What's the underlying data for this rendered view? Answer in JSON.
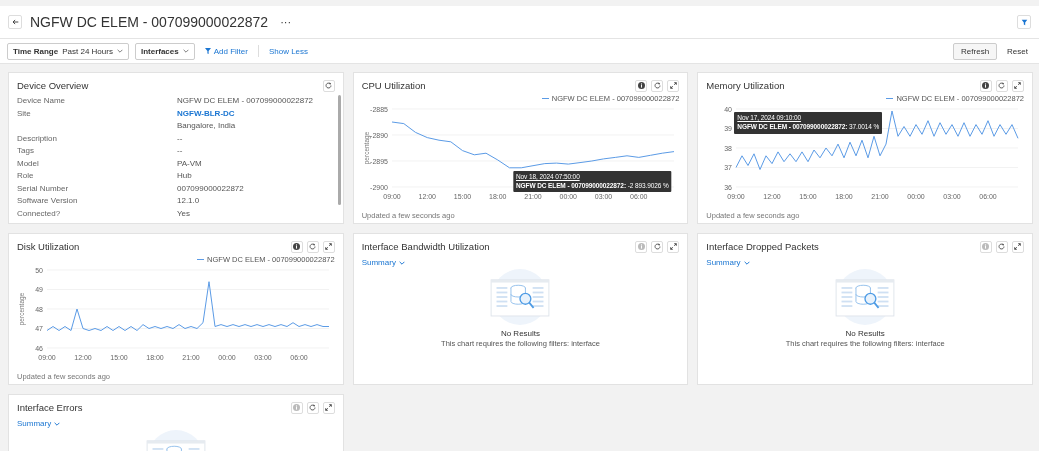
{
  "header": {
    "title": "NGFW DC ELEM - 007099000022872",
    "more": "···"
  },
  "filter_bar": {
    "time_range": {
      "label": "Time Range",
      "value": "Past 24 Hours"
    },
    "interfaces": {
      "label": "Interfaces"
    },
    "add_filter": "Add Filter",
    "show_less": "Show Less",
    "refresh": "Refresh",
    "reset": "Reset"
  },
  "panels": [
    {
      "kind": "details",
      "title": "Device Overview",
      "tools": [
        {
          "kind": "refresh",
          "disabled": false
        }
      ],
      "fields": [
        {
          "label": "Device Name",
          "value": "NGFW DC ELEM - 007099000022872"
        },
        {
          "label": "Site",
          "value": "NGFW-BLR-DC",
          "link": true,
          "note": "Bangalore, India"
        },
        {
          "label": "Description",
          "value": "--"
        },
        {
          "label": "Tags",
          "value": "--"
        },
        {
          "label": "Model",
          "value": "PA-VM"
        },
        {
          "label": "Role",
          "value": "Hub"
        },
        {
          "label": "Serial Number",
          "value": "007099000022872"
        },
        {
          "label": "Software Version",
          "value": "12.1.0"
        },
        {
          "label": "Connected?",
          "value": "Yes"
        }
      ]
    },
    {
      "kind": "chart",
      "title": "CPU Utilization",
      "tools": [
        {
          "kind": "info",
          "disabled": false
        },
        {
          "kind": "refresh",
          "disabled": false
        },
        {
          "kind": "expand",
          "disabled": false
        }
      ],
      "updated": "Updated a few seconds ago",
      "tooltip": {
        "at_end": true,
        "date": "Nov 18, 2024 07:50:00",
        "series": "NGFW DC ELEM - 007099000022872:",
        "value": "-2 893.9026 %"
      },
      "chart_data": {
        "type": "line",
        "ylabel": "percentage",
        "grid": true,
        "ylim": [
          -2900,
          -2885
        ],
        "yticks": [
          -2885,
          -2890,
          -2895,
          -2900
        ],
        "categories": [
          "09:00",
          null,
          null,
          "12:00",
          null,
          null,
          "15:00",
          null,
          null,
          "18:00",
          null,
          null,
          "21:00",
          null,
          null,
          "00:00",
          null,
          null,
          "03:00",
          null,
          null,
          "06:00",
          null,
          null,
          null
        ],
        "series": [
          {
            "name": "NGFW DC ELEM - 007099000022872",
            "color": "#5b9be6",
            "values": [
              -2887.5,
              -2887.8,
              -2889.5,
              -2890.5,
              -2891,
              -2891.3,
              -2893,
              -2893.8,
              -2893.5,
              -2894.8,
              -2896.3,
              -2896.3,
              -2895.9,
              -2895.5,
              -2895.4,
              -2895.6,
              -2895.3,
              -2895,
              -2894.6,
              -2894.3,
              -2894,
              -2894.3,
              -2893.9,
              -2893.5,
              -2893.2
            ]
          }
        ]
      }
    },
    {
      "kind": "chart",
      "title": "Memory Utilization",
      "tools": [
        {
          "kind": "info",
          "disabled": false
        },
        {
          "kind": "refresh",
          "disabled": false
        },
        {
          "kind": "expand",
          "disabled": false
        }
      ],
      "updated": "Updated a few seconds ago",
      "tooltip": {
        "at_end": false,
        "date": "Nov 17, 2024 09:10:00",
        "series": "NGFW DC ELEM - 007099000022872:",
        "value": "37.0014 %"
      },
      "chart_data": {
        "type": "line",
        "grid": true,
        "ylim": [
          36,
          40
        ],
        "yticks": [
          36,
          37,
          38,
          39,
          40
        ],
        "categories": [
          "09:00",
          null,
          null,
          null,
          null,
          null,
          "12:00",
          null,
          null,
          null,
          null,
          null,
          "15:00",
          null,
          null,
          null,
          null,
          null,
          "18:00",
          null,
          null,
          null,
          null,
          null,
          "21:00",
          null,
          null,
          null,
          null,
          null,
          "00:00",
          null,
          null,
          null,
          null,
          null,
          "03:00",
          null,
          null,
          null,
          null,
          null,
          "06:00",
          null,
          null,
          null,
          null,
          null
        ],
        "series": [
          {
            "name": "NGFW DC ELEM - 007099000022872",
            "color": "#5b9be6",
            "values": [
              37,
              37.6,
              37.1,
              37.7,
              36.9,
              37.6,
              37.2,
              37.8,
              37.3,
              37.7,
              37.3,
              37.8,
              37.3,
              37.9,
              37.5,
              38,
              37.6,
              38.2,
              37.5,
              38.3,
              37.6,
              38.4,
              37.5,
              38.6,
              37.6,
              38.2,
              39.9,
              38.6,
              39.1,
              38.6,
              39.2,
              38.7,
              39.4,
              38.6,
              39.3,
              38.7,
              39.2,
              38.6,
              39.3,
              38.6,
              39.2,
              38.7,
              39.4,
              38.6,
              39.2,
              38.7,
              39.2,
              38.5
            ]
          }
        ]
      }
    },
    {
      "kind": "chart",
      "title": "Disk Utilization",
      "tools": [
        {
          "kind": "info",
          "disabled": false
        },
        {
          "kind": "refresh",
          "disabled": false
        },
        {
          "kind": "expand",
          "disabled": false
        }
      ],
      "updated": "Updated a few seconds ago",
      "chart_data": {
        "type": "line",
        "ylabel": "percentage",
        "grid": true,
        "ylim": [
          46,
          50
        ],
        "yticks": [
          46,
          47,
          48,
          49,
          50
        ],
        "categories": [
          "09:00",
          null,
          null,
          null,
          null,
          null,
          "12:00",
          null,
          null,
          null,
          null,
          null,
          "15:00",
          null,
          null,
          null,
          null,
          null,
          "18:00",
          null,
          null,
          null,
          null,
          null,
          "21:00",
          null,
          null,
          null,
          null,
          null,
          "00:00",
          null,
          null,
          null,
          null,
          null,
          "03:00",
          null,
          null,
          null,
          null,
          null,
          "06:00",
          null,
          null,
          null,
          null,
          null
        ],
        "series": [
          {
            "name": "NGFW DC ELEM - 007099000022872",
            "color": "#5b9be6",
            "values": [
              46.9,
              47.1,
              46.9,
              47.1,
              46.9,
              48,
              47,
              46.9,
              47,
              46.9,
              47.1,
              46.9,
              47.1,
              46.9,
              47.1,
              46.9,
              47.2,
              47,
              47.1,
              47,
              47.1,
              47,
              47.2,
              47,
              47.1,
              47,
              47.3,
              49.4,
              47.1,
              47.2,
              47.1,
              47.2,
              47.1,
              47.2,
              47.1,
              47.2,
              47.1,
              47.2,
              47.1,
              47.2,
              47.1,
              47.3,
              47.1,
              47.2,
              47.1,
              47.2,
              47.1,
              47.1
            ]
          }
        ]
      }
    },
    {
      "kind": "empty",
      "title": "Interface Bandwidth Utilization",
      "tools": [
        {
          "kind": "info",
          "disabled": true
        },
        {
          "kind": "refresh",
          "disabled": false
        },
        {
          "kind": "expand",
          "disabled": false
        }
      ],
      "summary": "Summary",
      "message": "No Results",
      "hint": "This chart requires the following filters: interface"
    },
    {
      "kind": "empty",
      "title": "Interface Dropped Packets",
      "tools": [
        {
          "kind": "info",
          "disabled": true
        },
        {
          "kind": "refresh",
          "disabled": false
        },
        {
          "kind": "expand",
          "disabled": false
        }
      ],
      "summary": "Summary",
      "message": "No Results",
      "hint": "This chart requires the following filters: interface"
    },
    {
      "kind": "empty",
      "title": "Interface Errors",
      "tools": [
        {
          "kind": "info",
          "disabled": true
        },
        {
          "kind": "refresh",
          "disabled": false
        },
        {
          "kind": "expand",
          "disabled": false
        }
      ],
      "summary": "Summary"
    }
  ]
}
